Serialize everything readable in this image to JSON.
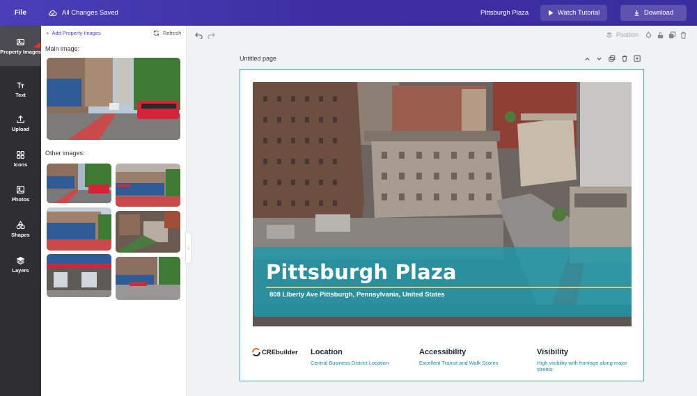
{
  "header": {
    "file_label": "File",
    "save_status": "All Changes Saved",
    "project_name": "Pittsburgh Plaza",
    "tutorial_label": "Watch Tutorial",
    "download_label": "Download"
  },
  "rail": {
    "items": [
      {
        "label": "Property Images",
        "icon": "images-icon",
        "active": true
      },
      {
        "label": "Text",
        "icon": "text-icon"
      },
      {
        "label": "Upload",
        "icon": "upload-icon"
      },
      {
        "label": "Icons",
        "icon": "grid-icon"
      },
      {
        "label": "Photos",
        "icon": "photo-icon"
      },
      {
        "label": "Shapes",
        "icon": "shapes-icon"
      },
      {
        "label": "Layers",
        "icon": "layers-icon"
      }
    ]
  },
  "panel": {
    "add_label": "Add Property Images",
    "refresh_label": "Refresh",
    "main_label": "Main image:",
    "other_label": "Other images:"
  },
  "workspace": {
    "position_label": "Position",
    "page_title": "Untitled page"
  },
  "flyer": {
    "title": "Pittsburgh Plaza",
    "address": "808 Liberty Ave Pittsburgh, Pennsylvania, United States",
    "logo_text": "CREbuilder",
    "features": [
      {
        "title": "Location",
        "text": "Central Business District Location"
      },
      {
        "title": "Accessibility",
        "text": "Excellent Transit and Walk Scores"
      },
      {
        "title": "Visibility",
        "text": "High visibility with frontage along major streets"
      }
    ]
  },
  "colors": {
    "brand_purple": "#3d2fa3",
    "rail_dark": "#2f2f33",
    "banner_teal": "#1e98aa",
    "accent_gold": "#e8c56a",
    "link_teal": "#1a8aa5"
  }
}
